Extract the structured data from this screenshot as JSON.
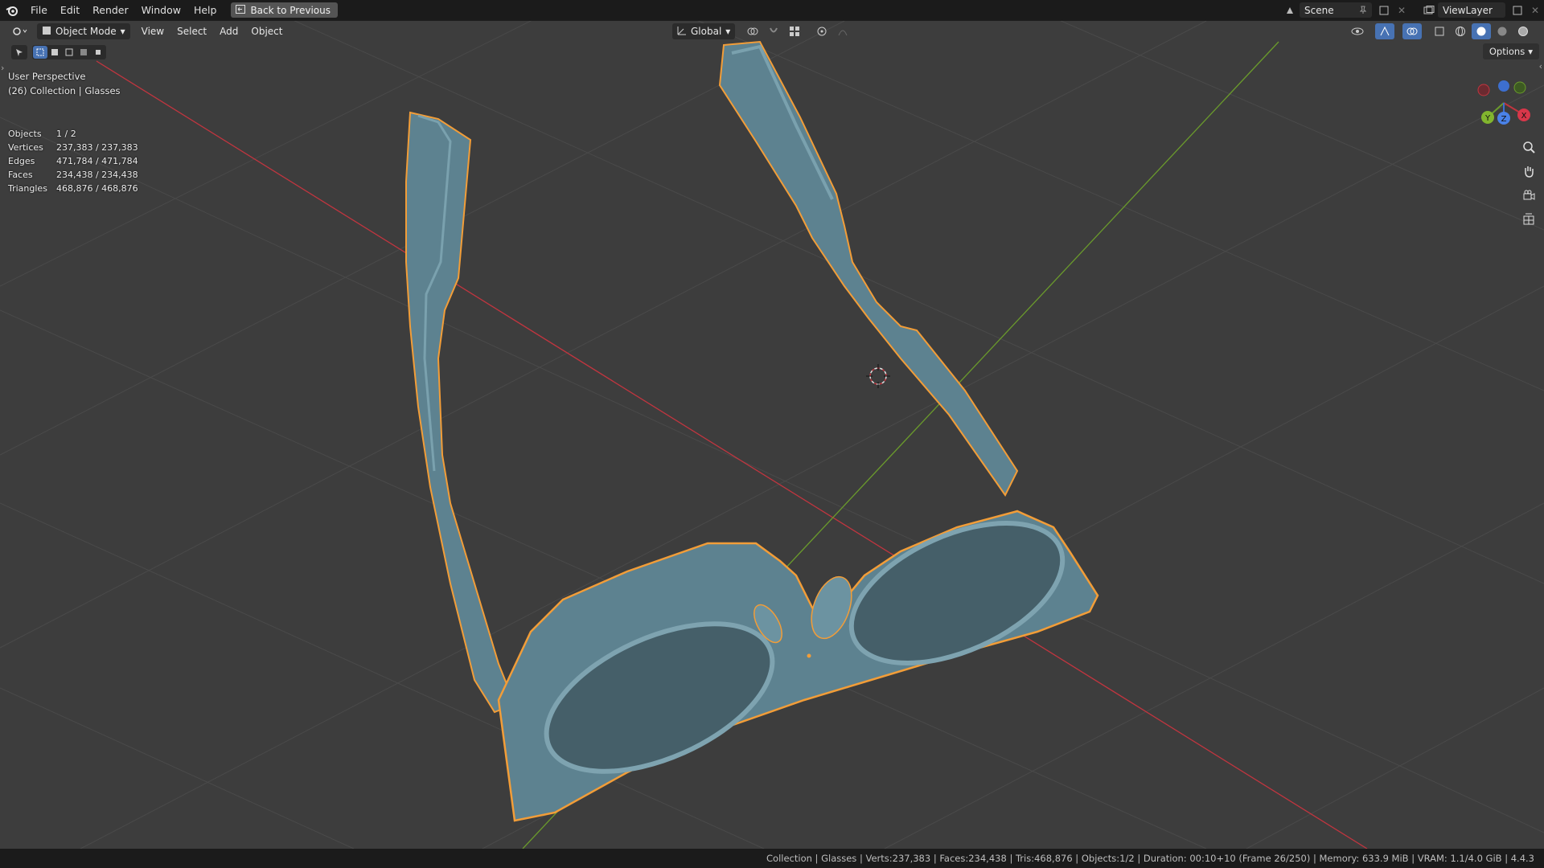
{
  "topbar": {
    "menu": [
      "File",
      "Edit",
      "Render",
      "Window",
      "Help"
    ],
    "back_button": "Back to Previous",
    "scene": "Scene",
    "view_layer": "ViewLayer"
  },
  "viewport_header": {
    "mode": "Object Mode",
    "menus": [
      "View",
      "Select",
      "Add",
      "Object"
    ],
    "transform_orientation": "Global",
    "options": "Options"
  },
  "overlay": {
    "perspective": "User Perspective",
    "collection": "(26) Collection | Glasses"
  },
  "stats": [
    {
      "label": "Objects",
      "value": "1 / 2"
    },
    {
      "label": "Vertices",
      "value": "237,383 / 237,383"
    },
    {
      "label": "Edges",
      "value": "471,784 / 471,784"
    },
    {
      "label": "Faces",
      "value": "234,438 / 234,438"
    },
    {
      "label": "Triangles",
      "value": "468,876 / 468,876"
    }
  ],
  "gizmo": {
    "x": "X",
    "y": "Y",
    "z": "Z"
  },
  "statusbar": {
    "text": "Collection | Glasses | Verts:237,383 | Faces:234,438 | Tris:468,876 | Objects:1/2 | Duration: 00:10+10 (Frame 26/250) | Memory: 633.9 MiB | VRAM: 1.1/4.0 GiB | 4.4.3"
  },
  "colors": {
    "viewport_bg": "#3d3d3d",
    "selection_outline": "#f29d38",
    "model": "#5d8290",
    "x_axis": "#c1353f",
    "y_axis": "#6a9a2c",
    "accent": "#4772b3"
  }
}
